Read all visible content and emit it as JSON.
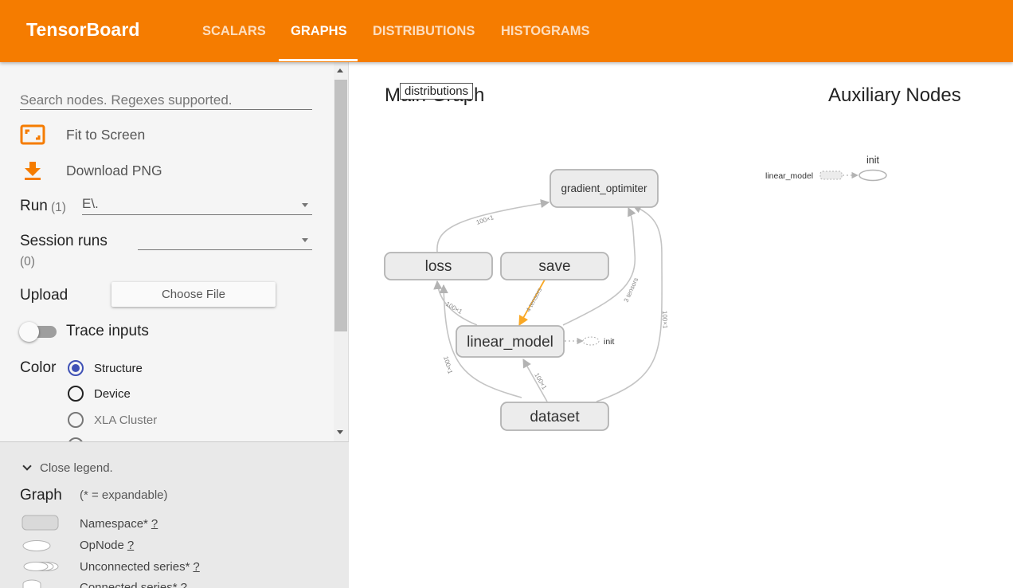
{
  "header": {
    "brand": "TensorBoard",
    "tabs": [
      {
        "label": "SCALARS"
      },
      {
        "label": "GRAPHS"
      },
      {
        "label": "DISTRIBUTIONS"
      },
      {
        "label": "HISTOGRAMS"
      }
    ],
    "active_tab": "GRAPHS"
  },
  "sidebar": {
    "search_placeholder": "Search nodes. Regexes supported.",
    "fit_to_screen": "Fit to Screen",
    "download_png": "Download PNG",
    "run_label": "Run",
    "run_count": "(1)",
    "run_value": "E\\.",
    "session_runs_label": "Session runs",
    "session_runs_count": "(0)",
    "session_runs_value": "",
    "upload_label": "Upload",
    "choose_file": "Choose File",
    "trace_inputs": "Trace inputs",
    "trace_inputs_on": false,
    "color_label": "Color",
    "color_options": [
      {
        "label": "Structure",
        "selected": true
      },
      {
        "label": "Device",
        "selected": false
      },
      {
        "label": "XLA Cluster",
        "selected": false
      }
    ]
  },
  "legend": {
    "close": "Close legend.",
    "title": "Graph",
    "note": "(* = expandable)",
    "items": [
      {
        "label": "Namespace*",
        "help": "?"
      },
      {
        "label": "OpNode",
        "help": "?"
      },
      {
        "label": "Unconnected series*",
        "help": "?"
      },
      {
        "label": "Connected series*",
        "help": "?"
      }
    ]
  },
  "canvas": {
    "main_title": "Main Graph",
    "tooltip": "distributions",
    "aux_title": "Auxiliary Nodes",
    "nodes": {
      "gradient_optimiter": "gradient_optimiter",
      "loss": "loss",
      "save": "save",
      "linear_model": "linear_model",
      "dataset": "dataset",
      "init": "init"
    },
    "edge_labels": {
      "loss_to_grad": "100×1",
      "linear_to_loss": "100×1",
      "dataset_to_loss": "100×1",
      "save_to_linear": "4 tensors",
      "linear_to_grad": "3 tensors",
      "dataset_to_grad": "100×1",
      "dataset_to_linear": "100×1"
    },
    "aux": {
      "linear_model": "linear_model",
      "init": "init"
    }
  },
  "colors": {
    "header": "#f57c00",
    "accent": "#f57c00",
    "radio_selected": "#3f51b5",
    "node_fill": "#ececec",
    "node_stroke": "#b3b3b3",
    "highlight_edge": "#f9a825"
  }
}
